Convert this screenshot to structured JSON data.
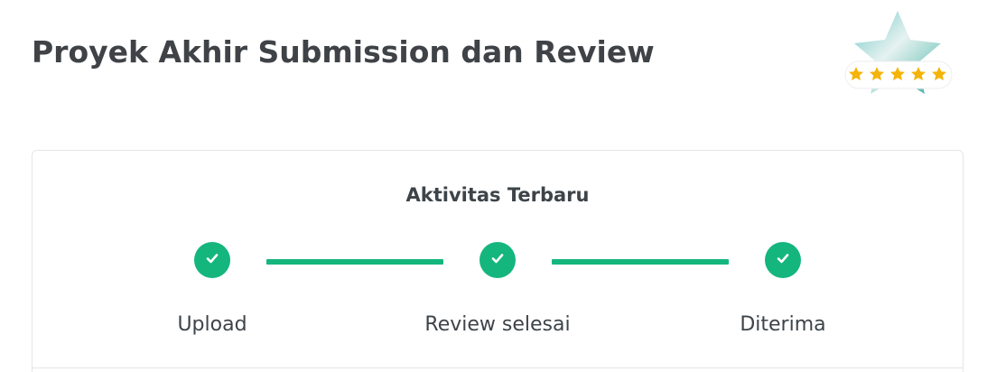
{
  "header": {
    "title": "Proyek Akhir Submission dan Review",
    "badge_icon": "star-rating-badge-icon"
  },
  "activity": {
    "title": "Aktivitas Terbaru",
    "steps": [
      {
        "label": "Upload",
        "icon": "check-icon",
        "completed": true
      },
      {
        "label": "Review selesai",
        "icon": "check-icon",
        "completed": true
      },
      {
        "label": "Diterima",
        "icon": "check-icon",
        "completed": true
      }
    ]
  },
  "colors": {
    "accent": "#14b67e",
    "star": "#f5b40b",
    "title": "#3f4347"
  }
}
